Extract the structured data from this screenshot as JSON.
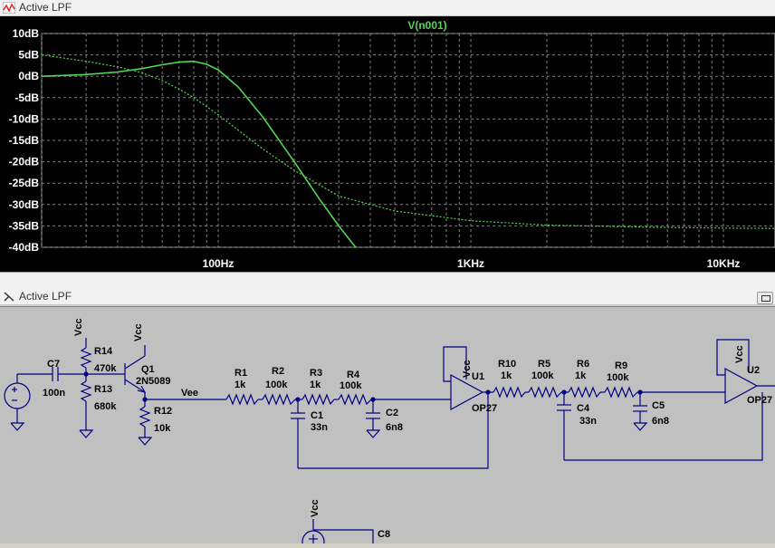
{
  "top_window": {
    "title": "Active LPF"
  },
  "bottom_window": {
    "title": "Active LPF"
  },
  "chart_data": {
    "type": "line",
    "title": "V(n001)",
    "x_scale": "log",
    "xlim": [
      20,
      16000
    ],
    "ylim": [
      -40,
      10
    ],
    "y_ticks": [
      10,
      5,
      0,
      -5,
      -10,
      -15,
      -20,
      -25,
      -30,
      -35,
      -40
    ],
    "y_tick_labels": [
      "10dB",
      "5dB",
      "0dB",
      "-5dB",
      "-10dB",
      "-15dB",
      "-20dB",
      "-25dB",
      "-30dB",
      "-35dB",
      "-40dB"
    ],
    "x_ticks": [
      100,
      1000,
      10000
    ],
    "x_tick_labels": [
      "100Hz",
      "1KHz",
      "10KHz"
    ],
    "grid": true,
    "series": [
      {
        "style": "solid",
        "color": "#54d454",
        "x": [
          20,
          30,
          40,
          50,
          60,
          70,
          80,
          90,
          100,
          120,
          150,
          200,
          250,
          300,
          350
        ],
        "y": [
          0.0,
          0.4,
          1.0,
          1.8,
          2.7,
          3.3,
          3.5,
          2.8,
          1.5,
          -2.5,
          -9.5,
          -20,
          -28.5,
          -35,
          -40
        ]
      },
      {
        "style": "dashed",
        "color": "#54d454",
        "x": [
          20,
          30,
          40,
          50,
          60,
          70,
          80,
          100,
          150,
          200,
          300,
          500,
          1000,
          2000,
          5000,
          10000,
          16000
        ],
        "y": [
          5.0,
          3.5,
          2.2,
          0.8,
          -1.0,
          -3.0,
          -5.0,
          -9.0,
          -17,
          -22,
          -28,
          -31.5,
          -33.8,
          -34.8,
          -35.3,
          -35.5,
          -35.6
        ]
      }
    ]
  },
  "schematic": {
    "labels": {
      "vcc1": "Vcc",
      "vcc2": "Vcc",
      "vcc3": "Vcc",
      "vcc4": "Vcc",
      "vcc5": "Vcc",
      "r14": "R14",
      "r14v": "470k",
      "r13": "R13",
      "r13v": "680k",
      "q1": "Q1",
      "q1v": "2N5089",
      "r12": "R12",
      "r12v": "10k",
      "c7": "C7",
      "c7v": "100n",
      "vee": "Vee",
      "r1": "R1",
      "r1v": "1k",
      "r2": "R2",
      "r2v": "100k",
      "r3": "R3",
      "r3v": "1k",
      "r4": "R4",
      "r4v": "100k",
      "c1": "C1",
      "c1v": "33n",
      "c2": "C2",
      "c2v": "6n8",
      "u1": "U1",
      "u1v": "OP27",
      "r10": "R10",
      "r10v": "1k",
      "r5": "R5",
      "r5v": "100k",
      "r6": "R6",
      "r6v": "1k",
      "r9": "R9",
      "r9v": "100k",
      "c4": "C4",
      "c4v": "33n",
      "c5": "C5",
      "c5v": "6n8",
      "u2": "U2",
      "u2v": "OP27",
      "c8": "C8"
    }
  }
}
